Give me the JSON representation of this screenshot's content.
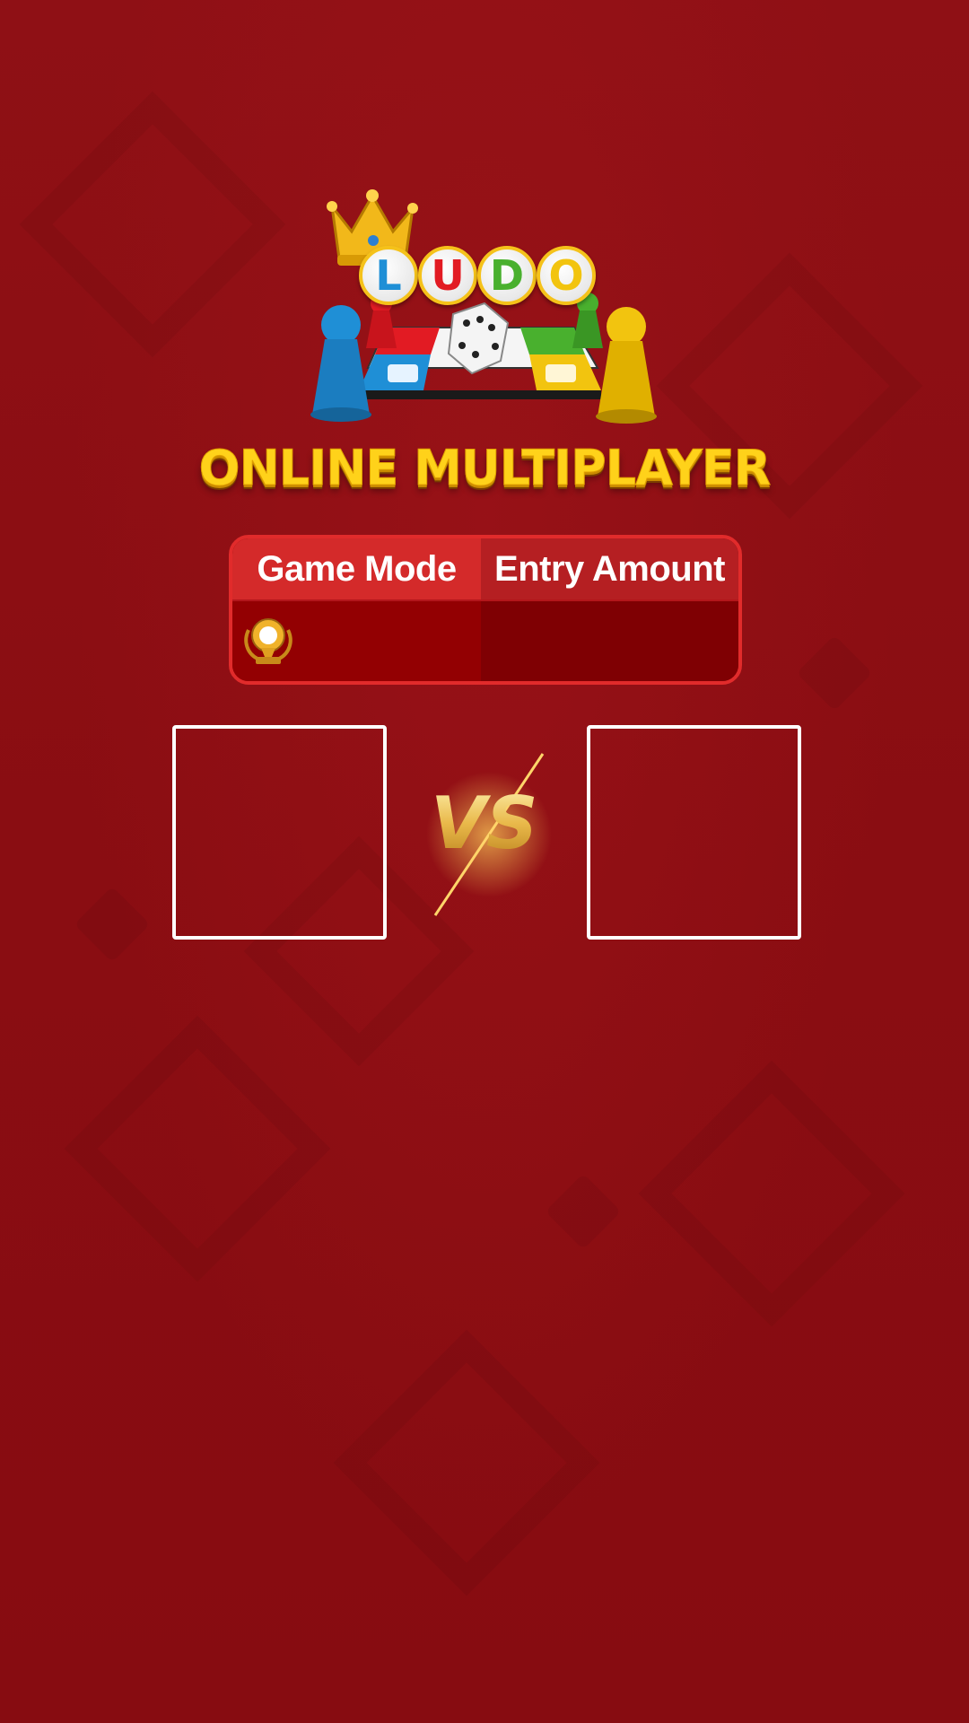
{
  "logo": {
    "letters": [
      {
        "char": "L",
        "color": "#1f8fd6"
      },
      {
        "char": "U",
        "color": "#e21b23"
      },
      {
        "char": "D",
        "color": "#49b02e"
      },
      {
        "char": "O",
        "color": "#f2c40f"
      }
    ]
  },
  "tagline": "ONLINE MULTIPLAYER",
  "info_table": {
    "headers": [
      "Game Mode",
      "Entry Amount"
    ],
    "row": {
      "mode_icon": "trophy-icon",
      "entry_amount": ""
    }
  },
  "vs_label": "VS",
  "colors": {
    "background": "#8a0d12",
    "accent_gold": "#ffd21a",
    "table_border": "#e12b2b"
  }
}
